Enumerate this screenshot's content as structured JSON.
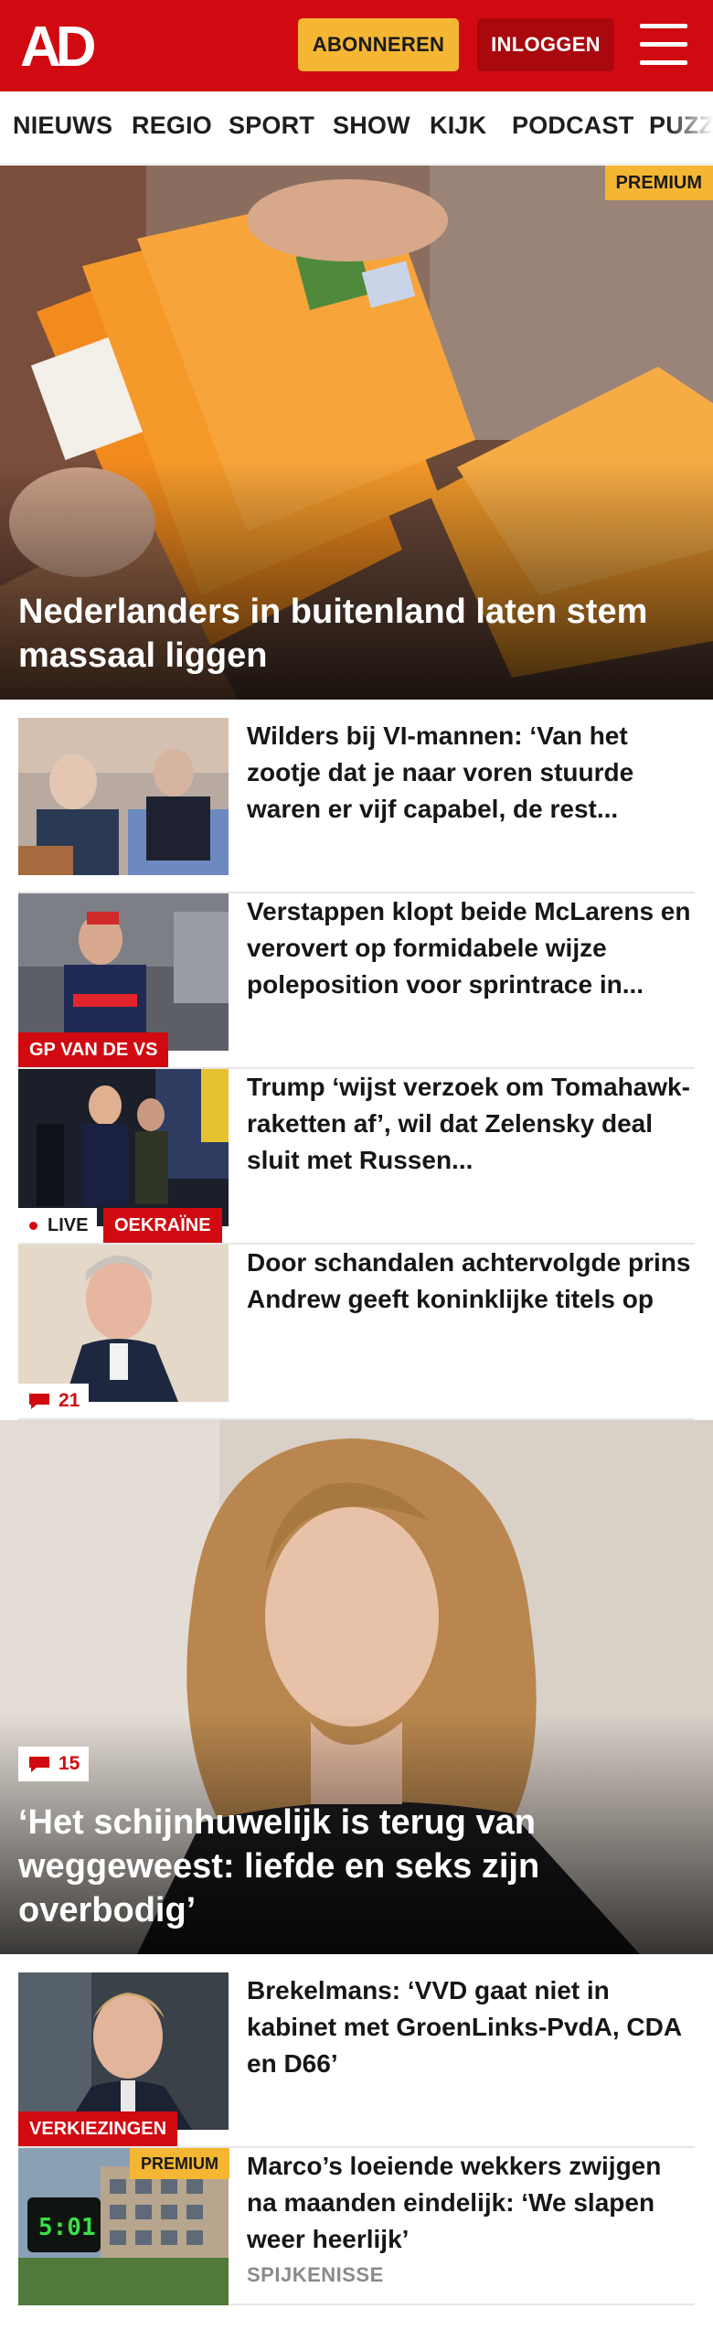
{
  "header": {
    "logo_text": "AD",
    "subscribe_label": "ABONNEREN",
    "login_label": "INLOGGEN",
    "brand_color": "#d10a11",
    "accent_color": "#f4b633",
    "menu_icon": "hamburger-menu-icon"
  },
  "nav": {
    "items": [
      "NIEUWS",
      "REGIO",
      "SPORT",
      "SHOW",
      "KIJK",
      "PODCAST",
      "PUZZ"
    ]
  },
  "hero1": {
    "badge": "PREMIUM",
    "title": "Nederlanders in buitenland laten stem massaal liggen"
  },
  "articles": [
    {
      "title": "Wilders bij VI-mannen: ‘Van het zootje dat je naar voren stuurde waren er vijf capabel, de rest..."
    },
    {
      "title": "Verstappen klopt beide McLarens en verovert op formidabele wijze poleposition voor sprintrace in...",
      "tag": "GP VAN DE VS"
    },
    {
      "title": "Trump ‘wijst verzoek om Tomahawk-raketten af’, wil dat Zelensky deal sluit met Russen...",
      "live": "LIVE",
      "tag": "OEKRAÏNE"
    },
    {
      "title": "Door schandalen achtervolgde prins Andrew geeft koninklijke titels op",
      "comments": "21"
    }
  ],
  "hero2": {
    "comments": "15",
    "title": "‘Het schijnhuwelijk is terug van weggeweest: liefde en seks zijn overbodig’"
  },
  "articles2": [
    {
      "title": "Brekelmans: ‘VVD gaat niet in kabinet met GroenLinks-PvdA, CDA en D66’",
      "tag": "VERKIEZINGEN"
    },
    {
      "title": "Marco’s loeiende wekkers zwijgen na maanden eindelijk: ‘We slapen weer heerlijk’",
      "badge": "PREMIUM",
      "location": "SPIJKENISSE",
      "clock": "5:01"
    }
  ]
}
